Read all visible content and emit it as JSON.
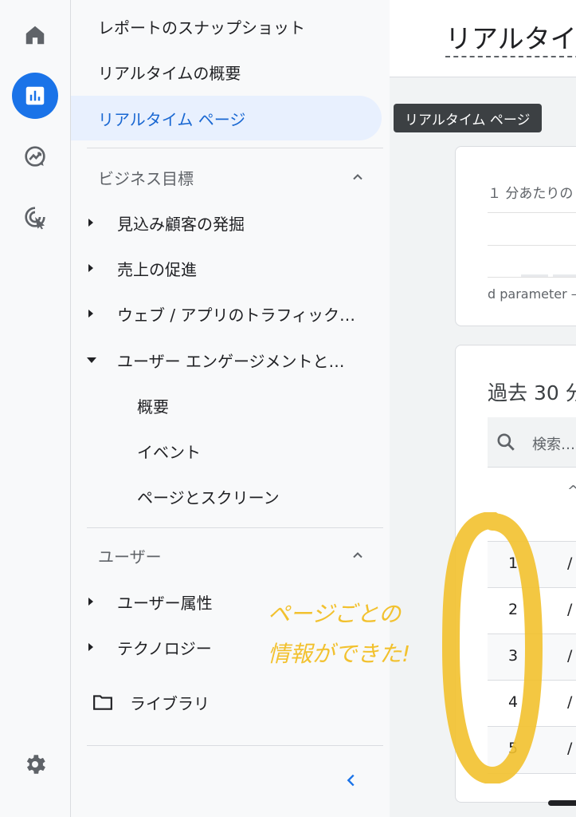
{
  "rail": {
    "items": [
      {
        "name": "home-icon"
      },
      {
        "name": "reports-icon",
        "active": true
      },
      {
        "name": "explore-icon"
      },
      {
        "name": "advertising-icon"
      }
    ],
    "settings": "gear-icon"
  },
  "nav": {
    "top_items": [
      {
        "label": "レポートのスナップショット"
      },
      {
        "label": "リアルタイムの概要"
      },
      {
        "label": "リアルタイム ページ",
        "active": true
      }
    ],
    "sections": [
      {
        "title": "ビジネス目標",
        "items": [
          {
            "label": "見込み顧客の発掘",
            "expanded": false
          },
          {
            "label": "売上の促進",
            "expanded": false
          },
          {
            "label": "ウェブ / アプリのトラフィック…",
            "expanded": false
          },
          {
            "label": "ユーザー エンゲージメントと…",
            "expanded": true,
            "children": [
              {
                "label": "概要"
              },
              {
                "label": "イベント"
              },
              {
                "label": "ページとスクリーン"
              }
            ]
          }
        ]
      },
      {
        "title": "ユーザー",
        "items": [
          {
            "label": "ユーザー属性",
            "expanded": false
          },
          {
            "label": "テクノロジー",
            "expanded": false
          }
        ]
      }
    ],
    "library_label": "ライブラリ",
    "collapse_icon": "chevron-left-icon"
  },
  "main": {
    "page_title": "リアルタイ",
    "tooltip": "リアルタイム ページ",
    "card1": {
      "subtitle": "１ 分あたりの",
      "axis_label": "d parameter –"
    },
    "card2": {
      "title": "過去 30 分",
      "search_placeholder": "検索…",
      "sort_glyph": "^",
      "rows": [
        {
          "rank": "1",
          "value": "/"
        },
        {
          "rank": "2",
          "value": "/"
        },
        {
          "rank": "3",
          "value": "/"
        },
        {
          "rank": "4",
          "value": "/"
        },
        {
          "rank": "5",
          "value": "/"
        }
      ]
    }
  },
  "annotation": {
    "line1": "ページごとの",
    "line2": "情報ができた!",
    "color": "#f2c12e"
  },
  "colors": {
    "accent": "#1a73e8",
    "active_bg": "#e8f0fe",
    "active_text": "#1967d2"
  }
}
